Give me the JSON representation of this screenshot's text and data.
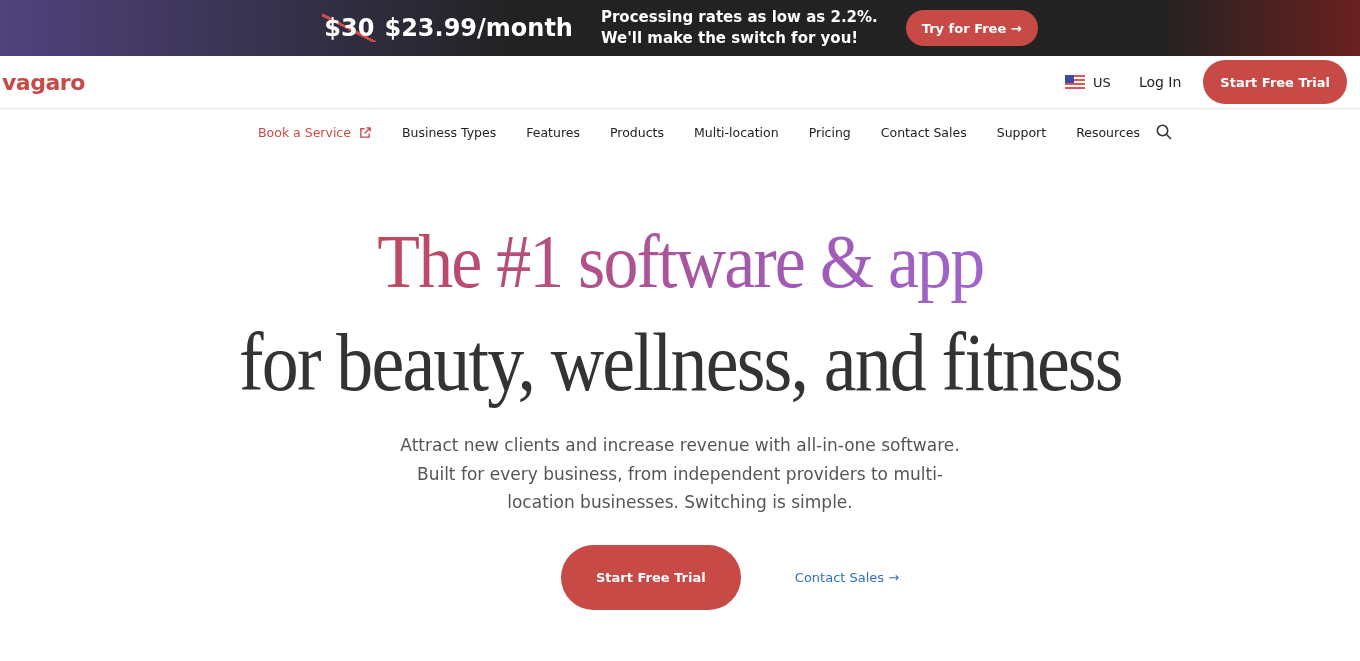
{
  "promo_banner": {
    "old_price": "$30",
    "price": "$23.99/month",
    "message_lines": [
      "Processing rates as low as 2.2%.",
      "We'll make the switch for you!"
    ],
    "button": {
      "label": "Try for Free",
      "arrow": "→"
    }
  },
  "header": {
    "logo": "vagaro",
    "region": "US",
    "login": "Log In",
    "cta": "Start Free Trial"
  },
  "nav": [
    {
      "label": "Book a Service",
      "selected": true,
      "external": true
    },
    {
      "label": "Business Types",
      "selected": false,
      "external": false
    },
    {
      "label": "Features",
      "selected": false,
      "external": false
    },
    {
      "label": "Products",
      "selected": false,
      "external": false
    },
    {
      "label": "Multi-location",
      "selected": false,
      "external": false
    },
    {
      "label": "Pricing",
      "selected": false,
      "external": false
    },
    {
      "label": "Contact Sales",
      "selected": false,
      "external": false
    },
    {
      "label": "Support",
      "selected": false,
      "external": false
    },
    {
      "label": "Resources",
      "selected": false,
      "external": false
    }
  ],
  "hero": {
    "headline_1": "The #1 software & app",
    "headline_2": "for beauty, wellness, and fitness",
    "description": "Attract new clients and increase revenue with all-in-one software. Built for every business, from independent providers to multi-location businesses. Switching is simple.",
    "primary_button": "Start Free Trial",
    "secondary_link": {
      "label": "Contact Sales",
      "arrow": "→"
    }
  }
}
